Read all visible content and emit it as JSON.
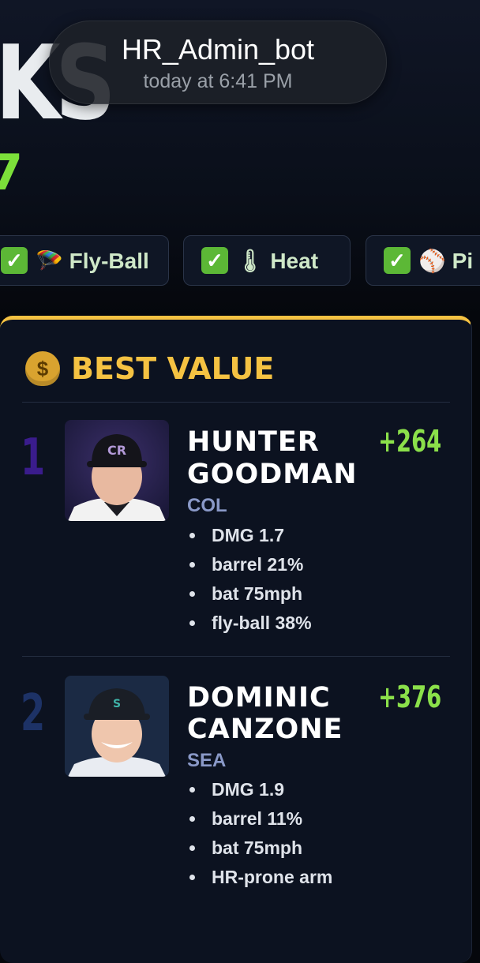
{
  "toast": {
    "title": "HR_Admin_bot",
    "time": "today at 6:41 PM"
  },
  "banner": {
    "partial_title": "KS",
    "partial_number": "7"
  },
  "filters": [
    {
      "label": "🪂 Fly-Ball"
    },
    {
      "label": "🌡 Heat"
    },
    {
      "label": "⚾ Pi"
    }
  ],
  "section": {
    "icon": "money-bag-icon",
    "icon_glyph": "$",
    "title": "BEST VALUE"
  },
  "players": [
    {
      "rank": "1",
      "name_line1": "HUNTER",
      "name_line2": "GOODMAN",
      "team": "COL",
      "odds": "+264",
      "stats": [
        "DMG 1.7",
        "barrel 21%",
        "bat 75mph",
        "fly-ball 38%"
      ]
    },
    {
      "rank": "2",
      "name_line1": "DOMINIC",
      "name_line2": "CANZONE",
      "team": "SEA",
      "odds": "+376",
      "stats": [
        "DMG 1.9",
        "barrel 11%",
        "bat 75mph",
        "HR-prone arm"
      ]
    }
  ],
  "colors": {
    "accent_gold": "#f5c242",
    "odds_green": "#8be04a",
    "rank1": "#3a1c8c",
    "rank2": "#1d3266"
  }
}
